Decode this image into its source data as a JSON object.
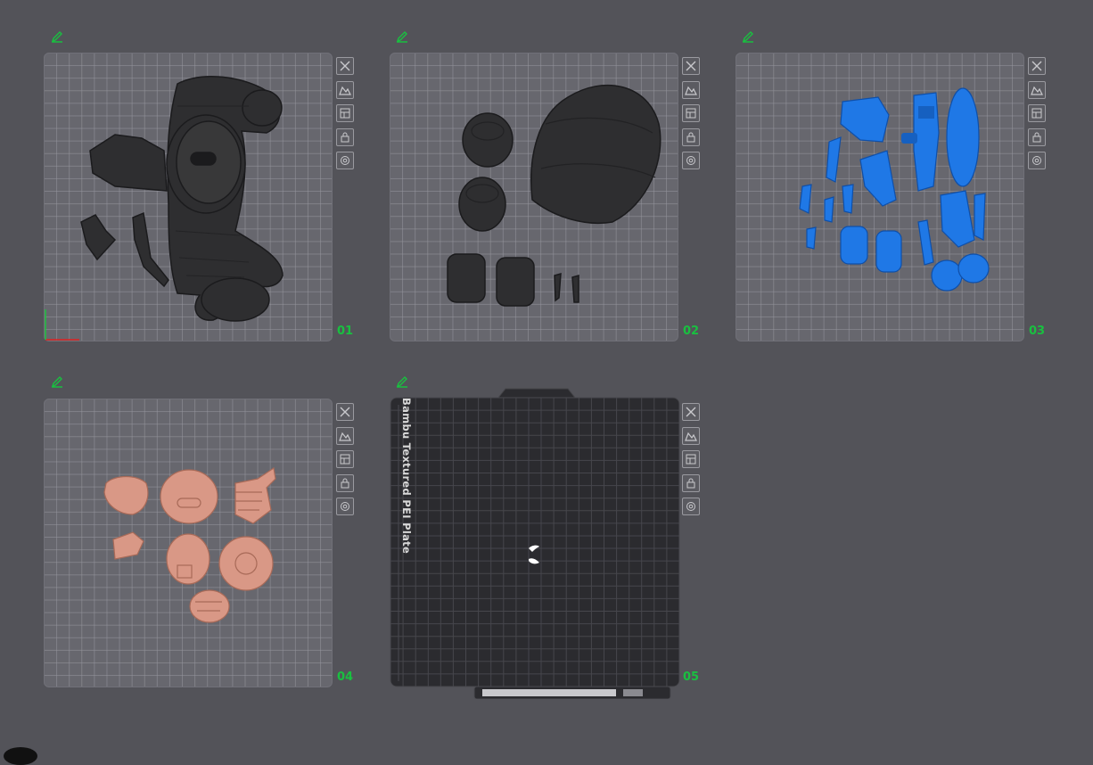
{
  "plates": [
    {
      "number": "01"
    },
    {
      "number": "02"
    },
    {
      "number": "03"
    },
    {
      "number": "04"
    },
    {
      "number": "05",
      "plate_type": "Bambu Textured PEI Plate"
    }
  ],
  "tools": [
    "close-icon",
    "auto-orient-icon",
    "arrange-icon",
    "lock-icon",
    "settings-icon"
  ],
  "colors": {
    "background": "#535359",
    "plate": "#67676e",
    "accent_green": "#19c040",
    "black_model": "#2e2e30",
    "blue_model": "#1f78e6",
    "skin_model": "#d99886",
    "textured_plate": "#2b2b2f"
  }
}
